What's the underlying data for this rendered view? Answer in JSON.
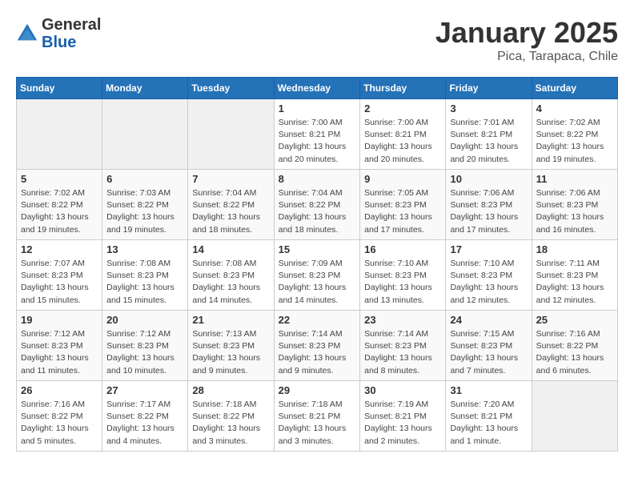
{
  "header": {
    "logo_general": "General",
    "logo_blue": "Blue",
    "title": "January 2025",
    "subtitle": "Pica, Tarapaca, Chile"
  },
  "weekdays": [
    "Sunday",
    "Monday",
    "Tuesday",
    "Wednesday",
    "Thursday",
    "Friday",
    "Saturday"
  ],
  "weeks": [
    [
      {
        "day": "",
        "info": ""
      },
      {
        "day": "",
        "info": ""
      },
      {
        "day": "",
        "info": ""
      },
      {
        "day": "1",
        "info": "Sunrise: 7:00 AM\nSunset: 8:21 PM\nDaylight: 13 hours\nand 20 minutes."
      },
      {
        "day": "2",
        "info": "Sunrise: 7:00 AM\nSunset: 8:21 PM\nDaylight: 13 hours\nand 20 minutes."
      },
      {
        "day": "3",
        "info": "Sunrise: 7:01 AM\nSunset: 8:21 PM\nDaylight: 13 hours\nand 20 minutes."
      },
      {
        "day": "4",
        "info": "Sunrise: 7:02 AM\nSunset: 8:22 PM\nDaylight: 13 hours\nand 19 minutes."
      }
    ],
    [
      {
        "day": "5",
        "info": "Sunrise: 7:02 AM\nSunset: 8:22 PM\nDaylight: 13 hours\nand 19 minutes."
      },
      {
        "day": "6",
        "info": "Sunrise: 7:03 AM\nSunset: 8:22 PM\nDaylight: 13 hours\nand 19 minutes."
      },
      {
        "day": "7",
        "info": "Sunrise: 7:04 AM\nSunset: 8:22 PM\nDaylight: 13 hours\nand 18 minutes."
      },
      {
        "day": "8",
        "info": "Sunrise: 7:04 AM\nSunset: 8:22 PM\nDaylight: 13 hours\nand 18 minutes."
      },
      {
        "day": "9",
        "info": "Sunrise: 7:05 AM\nSunset: 8:23 PM\nDaylight: 13 hours\nand 17 minutes."
      },
      {
        "day": "10",
        "info": "Sunrise: 7:06 AM\nSunset: 8:23 PM\nDaylight: 13 hours\nand 17 minutes."
      },
      {
        "day": "11",
        "info": "Sunrise: 7:06 AM\nSunset: 8:23 PM\nDaylight: 13 hours\nand 16 minutes."
      }
    ],
    [
      {
        "day": "12",
        "info": "Sunrise: 7:07 AM\nSunset: 8:23 PM\nDaylight: 13 hours\nand 15 minutes."
      },
      {
        "day": "13",
        "info": "Sunrise: 7:08 AM\nSunset: 8:23 PM\nDaylight: 13 hours\nand 15 minutes."
      },
      {
        "day": "14",
        "info": "Sunrise: 7:08 AM\nSunset: 8:23 PM\nDaylight: 13 hours\nand 14 minutes."
      },
      {
        "day": "15",
        "info": "Sunrise: 7:09 AM\nSunset: 8:23 PM\nDaylight: 13 hours\nand 14 minutes."
      },
      {
        "day": "16",
        "info": "Sunrise: 7:10 AM\nSunset: 8:23 PM\nDaylight: 13 hours\nand 13 minutes."
      },
      {
        "day": "17",
        "info": "Sunrise: 7:10 AM\nSunset: 8:23 PM\nDaylight: 13 hours\nand 12 minutes."
      },
      {
        "day": "18",
        "info": "Sunrise: 7:11 AM\nSunset: 8:23 PM\nDaylight: 13 hours\nand 12 minutes."
      }
    ],
    [
      {
        "day": "19",
        "info": "Sunrise: 7:12 AM\nSunset: 8:23 PM\nDaylight: 13 hours\nand 11 minutes."
      },
      {
        "day": "20",
        "info": "Sunrise: 7:12 AM\nSunset: 8:23 PM\nDaylight: 13 hours\nand 10 minutes."
      },
      {
        "day": "21",
        "info": "Sunrise: 7:13 AM\nSunset: 8:23 PM\nDaylight: 13 hours\nand 9 minutes."
      },
      {
        "day": "22",
        "info": "Sunrise: 7:14 AM\nSunset: 8:23 PM\nDaylight: 13 hours\nand 9 minutes."
      },
      {
        "day": "23",
        "info": "Sunrise: 7:14 AM\nSunset: 8:23 PM\nDaylight: 13 hours\nand 8 minutes."
      },
      {
        "day": "24",
        "info": "Sunrise: 7:15 AM\nSunset: 8:23 PM\nDaylight: 13 hours\nand 7 minutes."
      },
      {
        "day": "25",
        "info": "Sunrise: 7:16 AM\nSunset: 8:22 PM\nDaylight: 13 hours\nand 6 minutes."
      }
    ],
    [
      {
        "day": "26",
        "info": "Sunrise: 7:16 AM\nSunset: 8:22 PM\nDaylight: 13 hours\nand 5 minutes."
      },
      {
        "day": "27",
        "info": "Sunrise: 7:17 AM\nSunset: 8:22 PM\nDaylight: 13 hours\nand 4 minutes."
      },
      {
        "day": "28",
        "info": "Sunrise: 7:18 AM\nSunset: 8:22 PM\nDaylight: 13 hours\nand 3 minutes."
      },
      {
        "day": "29",
        "info": "Sunrise: 7:18 AM\nSunset: 8:21 PM\nDaylight: 13 hours\nand 3 minutes."
      },
      {
        "day": "30",
        "info": "Sunrise: 7:19 AM\nSunset: 8:21 PM\nDaylight: 13 hours\nand 2 minutes."
      },
      {
        "day": "31",
        "info": "Sunrise: 7:20 AM\nSunset: 8:21 PM\nDaylight: 13 hours\nand 1 minute."
      },
      {
        "day": "",
        "info": ""
      }
    ]
  ]
}
